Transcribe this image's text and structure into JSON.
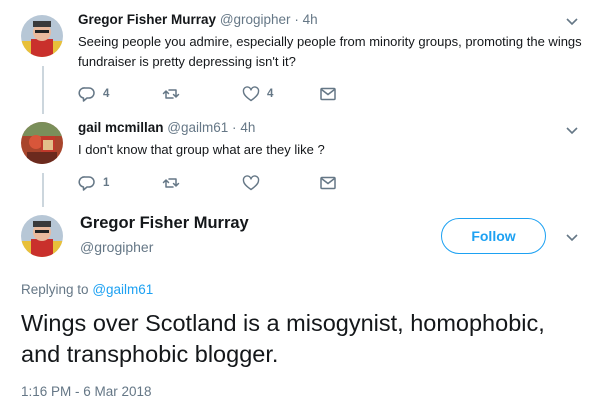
{
  "tweets": [
    {
      "display_name": "Gregor Fisher Murray",
      "handle": "@grogipher",
      "time": "4h",
      "text": "Seeing people you admire, especially people from minority groups, promoting the wings fundraiser is pretty depressing isn't it?",
      "reply_count": "4",
      "retweet_count": "",
      "like_count": "4"
    },
    {
      "display_name": "gail mcmillan",
      "handle": "@gailm61",
      "time": "4h",
      "text": "I don't know that group what are they like ?",
      "reply_count": "1",
      "retweet_count": "",
      "like_count": ""
    }
  ],
  "main_tweet": {
    "display_name": "Gregor Fisher Murray",
    "handle": "@grogipher",
    "follow_label": "Follow",
    "replying_prefix": "Replying to",
    "replying_to": "@gailm61",
    "text": "Wings over Scotland is a misogynist, homophobic, and transphobic blogger.",
    "timestamp": "1:16 PM - 6 Mar 2018"
  },
  "separator": "·",
  "colors": {
    "accent": "#1da1f2",
    "secondary_text": "#657786",
    "primary_text": "#14171a",
    "thread_line": "#ccd6dd"
  },
  "icons": [
    "reply-icon",
    "retweet-icon",
    "like-icon",
    "direct-message-icon",
    "chevron-down-icon"
  ]
}
